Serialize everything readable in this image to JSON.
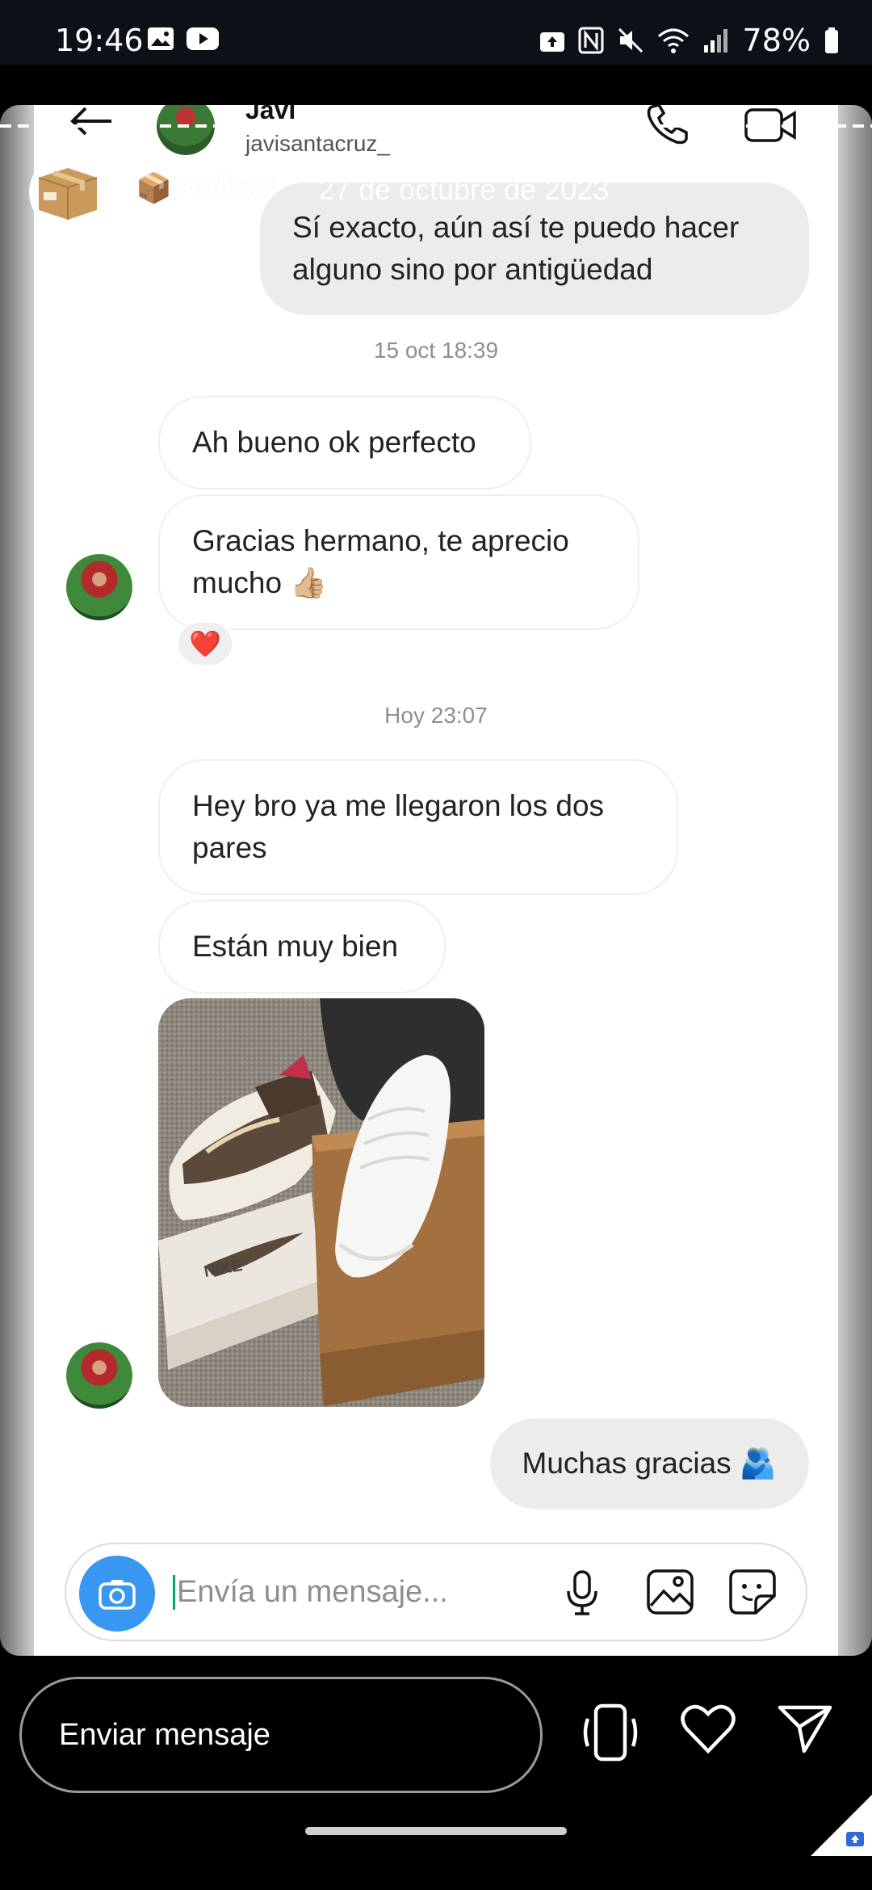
{
  "status_bar": {
    "time": "19:46",
    "battery": "78%",
    "left_icons": [
      "gallery-icon",
      "youtube-icon"
    ],
    "right_icons": [
      "upload-icon",
      "nfc-icon",
      "mute-icon",
      "wifi-icon",
      "signal-icon",
      "battery-icon"
    ]
  },
  "story": {
    "title": "📦Pedido²",
    "date": "27 de octubre de 2023",
    "avatar_icon": "package-box-icon"
  },
  "chat_header": {
    "name": "Javi",
    "username": "javisantacruz_"
  },
  "messages": [
    {
      "type": "outgoing",
      "text": "Sí exacto, aún así te puedo hacer alguno sino por antigüedad"
    },
    {
      "type": "date",
      "text": "15 oct 18:39"
    },
    {
      "type": "incoming",
      "text": "Ah bueno ok perfecto"
    },
    {
      "type": "incoming",
      "text": "Gracias hermano, te aprecio mucho 👍🏼"
    },
    {
      "type": "reaction",
      "text": "❤️"
    },
    {
      "type": "date",
      "text": "Hoy 23:07"
    },
    {
      "type": "incoming",
      "text": "Hey bro ya me llegaron los dos pares"
    },
    {
      "type": "incoming",
      "text": "Están muy bien"
    },
    {
      "type": "photo",
      "brand_text": "NIKE"
    },
    {
      "type": "outgoing",
      "text": "Muchas gracias 🫂"
    }
  ],
  "composer": {
    "placeholder": "Envía un mensaje..."
  },
  "bottom_bar": {
    "send_placeholder": "Enviar mensaje"
  },
  "colors": {
    "accent_blue": "#3897f0",
    "heart_red": "#e02030",
    "bubble_out": "#ececec"
  }
}
